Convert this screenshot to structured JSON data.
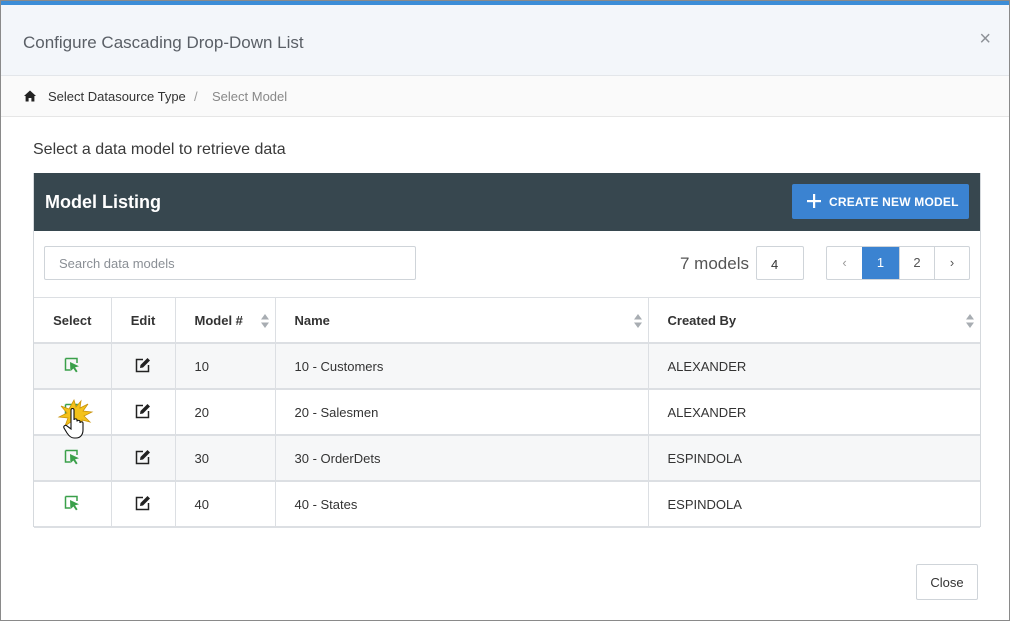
{
  "dialog": {
    "title": "Configure Cascading Drop-Down List",
    "close_glyph": "×"
  },
  "breadcrumb": {
    "home_icon": "home-icon",
    "items": [
      "Select Datasource Type",
      "Select Model"
    ],
    "separator": "/"
  },
  "intro_text": "Select a data model to retrieve data",
  "panel": {
    "title": "Model Listing",
    "create_button_label": "CREATE NEW MODEL",
    "header_color": "#37474f",
    "accent_color": "#3b83d1"
  },
  "search": {
    "placeholder": "Search data models",
    "value": ""
  },
  "model_count": "7 models",
  "page_size": "4",
  "pagination": {
    "prev": "‹",
    "pages": [
      "1",
      "2"
    ],
    "active_page": "1",
    "next": "›"
  },
  "table": {
    "columns": [
      "Select",
      "Edit",
      "Model #",
      "Name",
      "Created By"
    ],
    "rows": [
      {
        "model_no": "10",
        "name": "10 - Customers",
        "created_by": "ALEXANDER"
      },
      {
        "model_no": "20",
        "name": "20 - Salesmen",
        "created_by": "ALEXANDER"
      },
      {
        "model_no": "30",
        "name": "30 - OrderDets",
        "created_by": "ESPINDOLA"
      },
      {
        "model_no": "40",
        "name": "40 - States",
        "created_by": "ESPINDOLA"
      }
    ],
    "select_icon": "select-cursor-icon",
    "edit_icon": "edit-icon",
    "select_icon_color": "#3aa04a"
  },
  "footer": {
    "close_label": "Close"
  }
}
